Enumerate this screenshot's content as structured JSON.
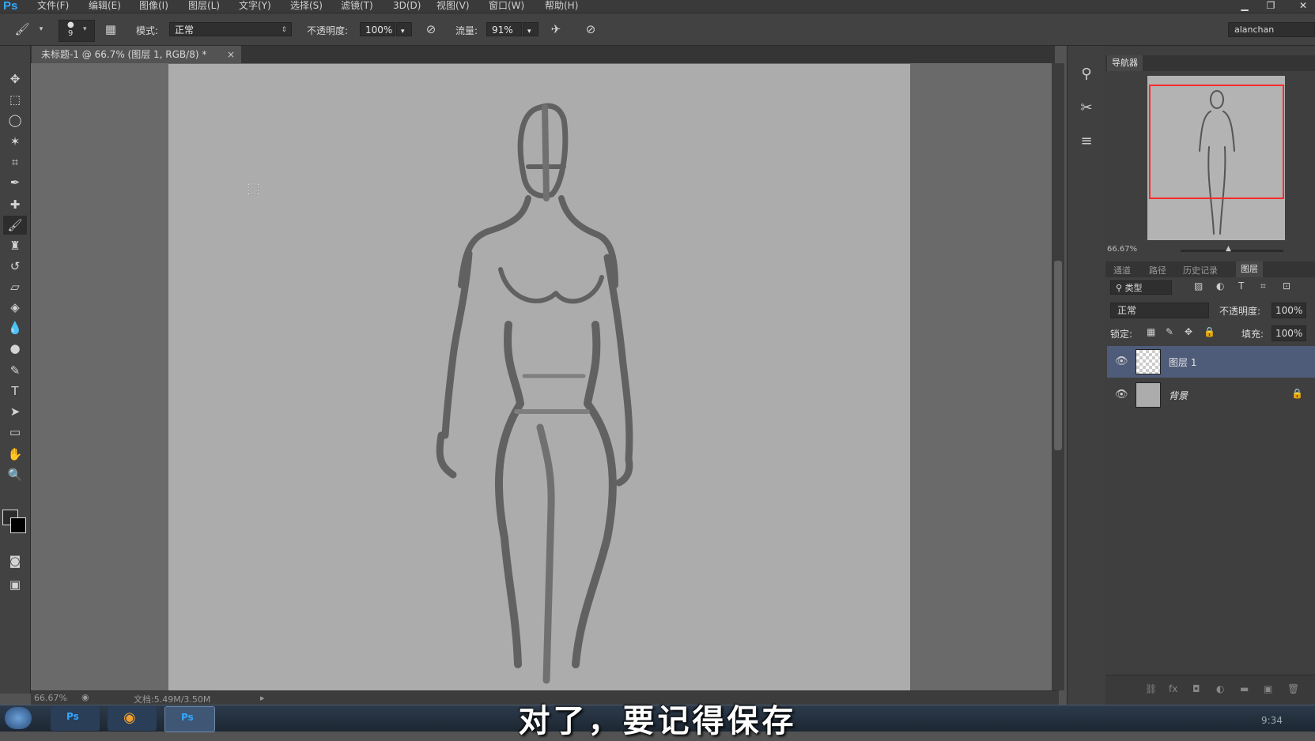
{
  "app": {
    "logo": "Ps"
  },
  "menu": [
    "文件(F)",
    "编辑(E)",
    "图像(I)",
    "图层(L)",
    "文字(Y)",
    "选择(S)",
    "滤镜(T)",
    "3D(D)",
    "视图(V)",
    "窗口(W)",
    "帮助(H)"
  ],
  "options": {
    "brush_size": "9",
    "mode_label": "模式:",
    "mode_value": "正常",
    "opacity_label": "不透明度:",
    "opacity_value": "100%",
    "flow_label": "流量:",
    "flow_value": "91%",
    "workspace": "alanchan"
  },
  "document": {
    "tab_title": "未标题-1 @ 66.7% (图层 1, RGB/8) *",
    "close": "×"
  },
  "status": {
    "zoom": "66.67%",
    "doc_info": "文档:5.49M/3.50M"
  },
  "navigator": {
    "title": "导航器",
    "zoom": "66.67%"
  },
  "panels": {
    "tabs": [
      "通道",
      "路径",
      "历史记录",
      "图层"
    ],
    "active_tab": "图层",
    "filter_label": "类型",
    "blend_mode": "正常",
    "opacity_label": "不透明度:",
    "opacity_value": "100%",
    "lock_label": "锁定:",
    "fill_label": "填充:",
    "fill_value": "100%"
  },
  "layers": [
    {
      "name": "图层 1",
      "selected": true
    },
    {
      "name": "背景",
      "selected": false,
      "locked": true
    }
  ],
  "subtitle": "对了，要记得保存",
  "clock": "9:34",
  "colors": {
    "accent": "#31a8ff",
    "selection": "#4f5c79",
    "nav_frame": "#ff2a2a"
  }
}
